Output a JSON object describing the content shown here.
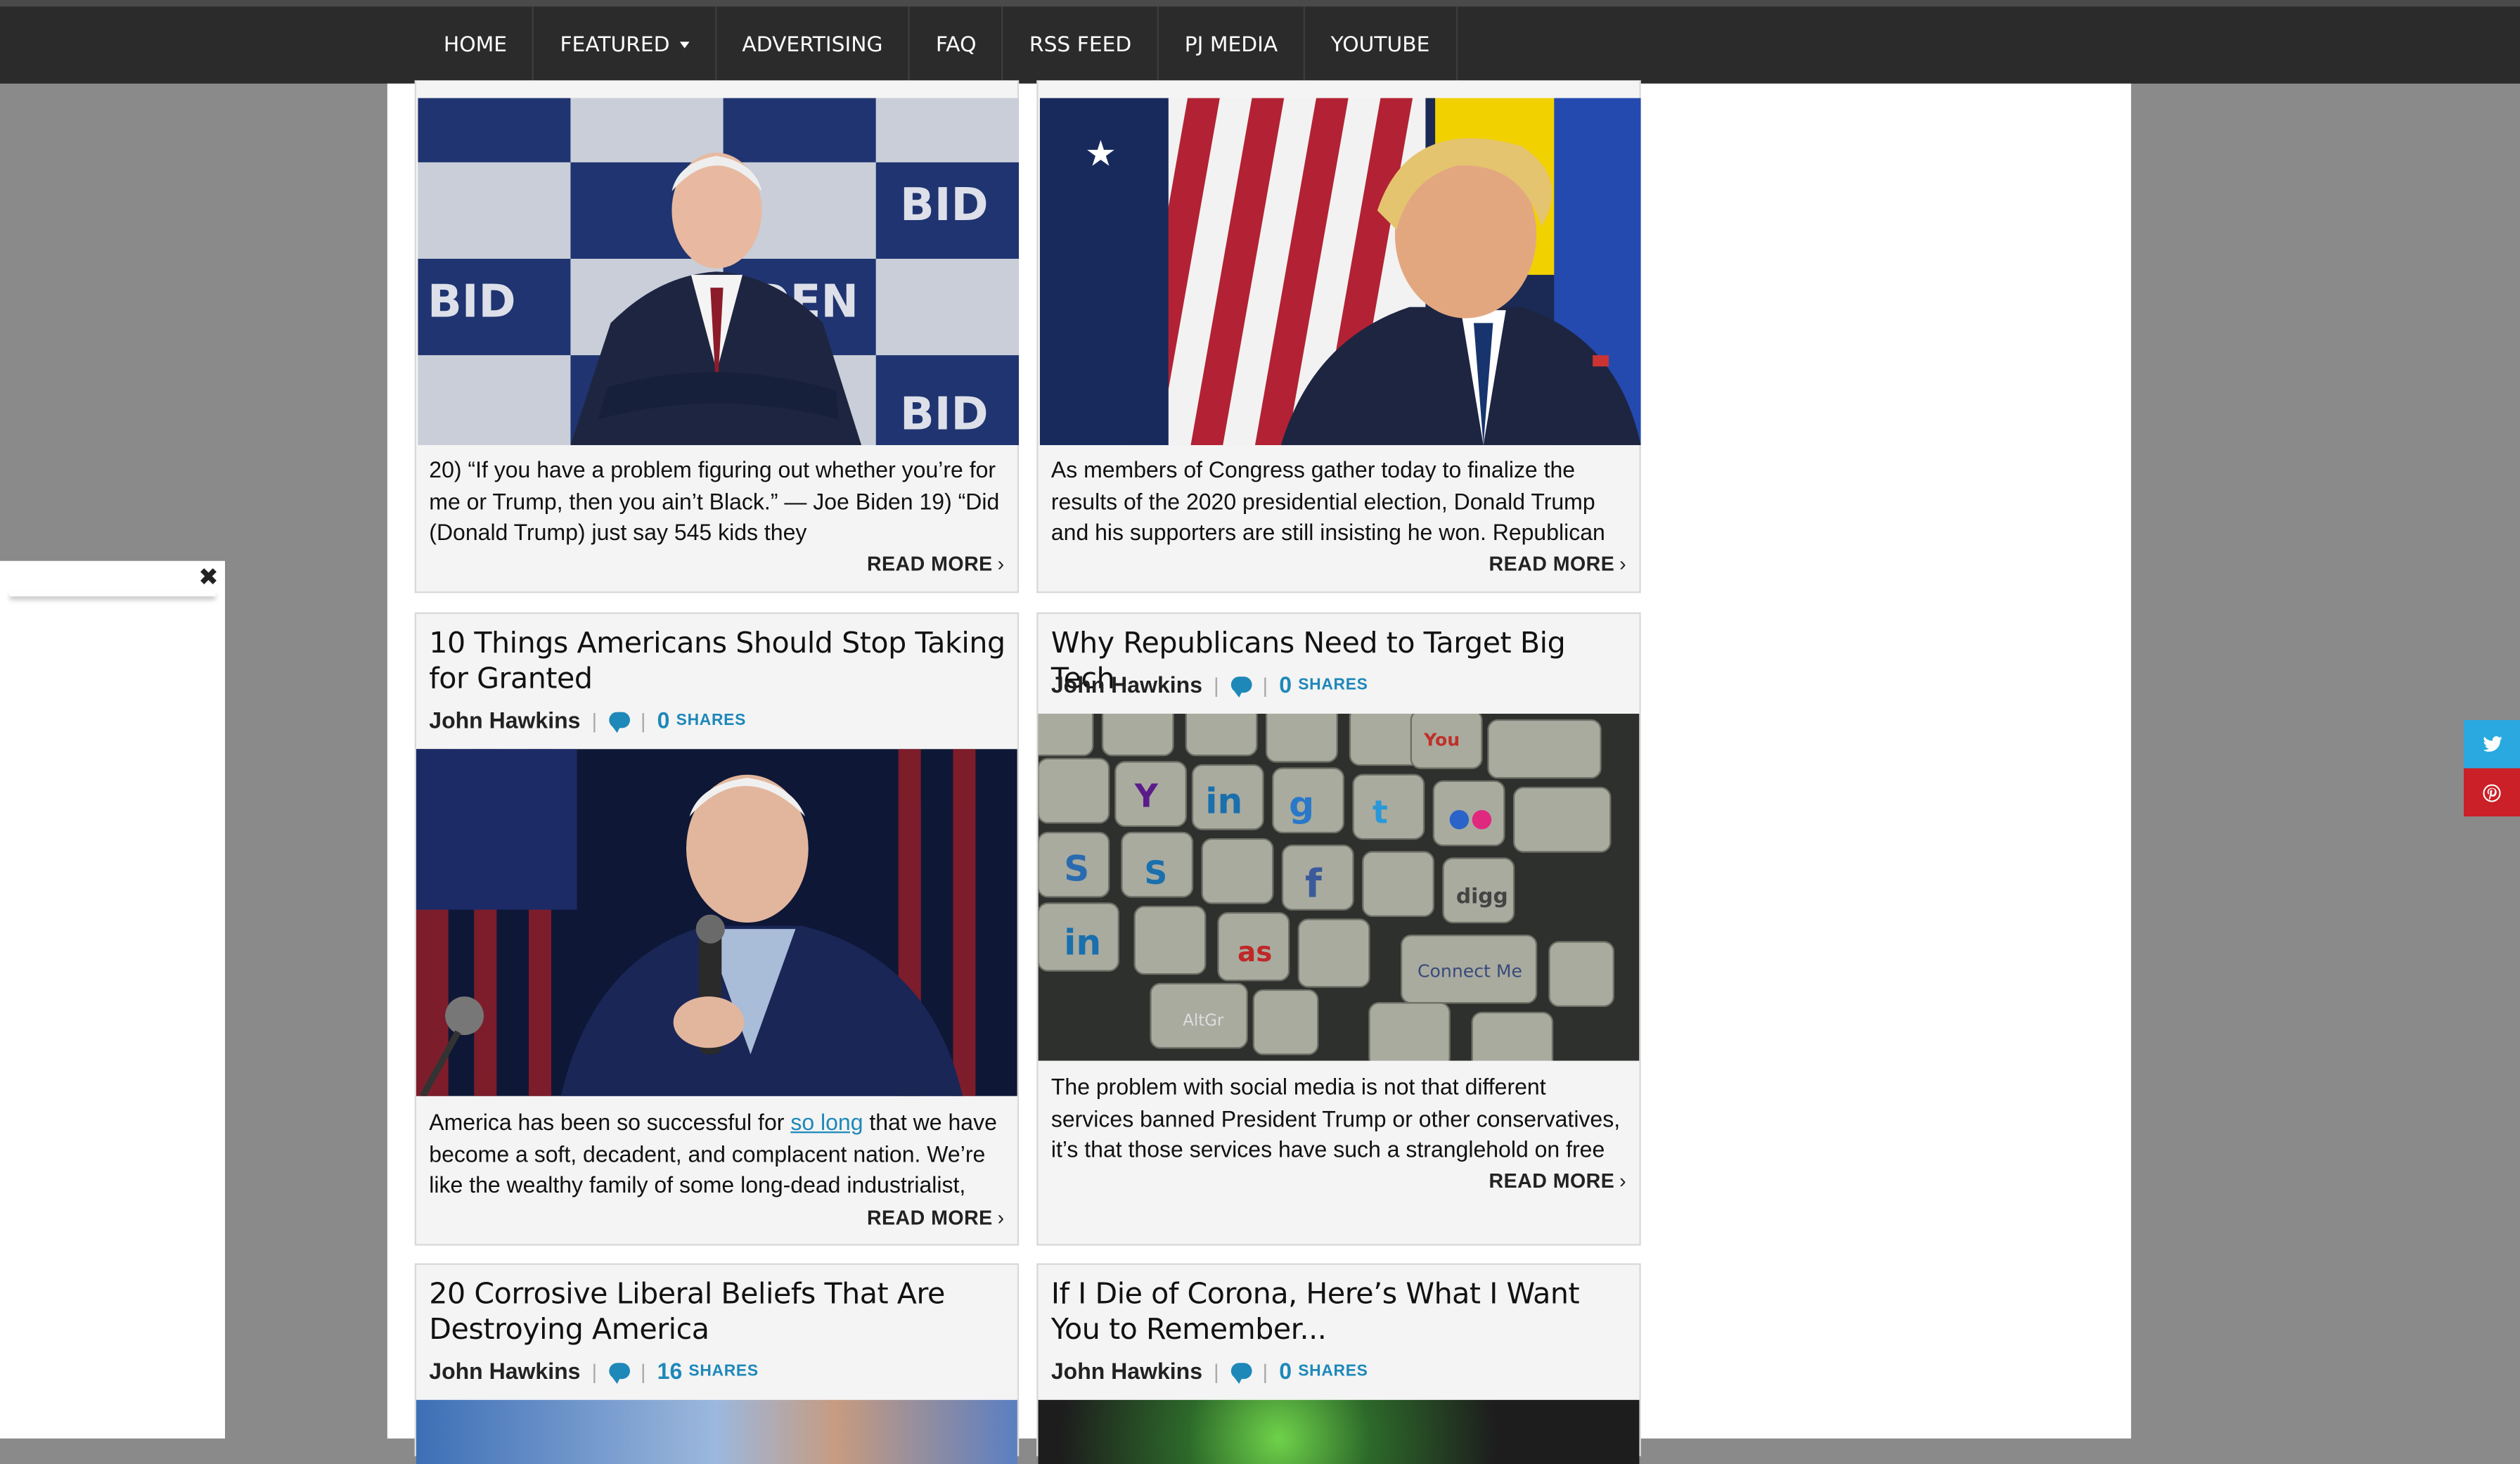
{
  "nav": {
    "items": [
      "HOME",
      "FEATURED",
      "ADVERTISING",
      "FAQ",
      "RSS FEED",
      "PJ MEDIA",
      "YOUTUBE"
    ]
  },
  "cards": [
    {
      "image_alt": "Joe Biden smiling with arms crossed in front of Biden campaign backdrop",
      "excerpt": "20) “If you have a problem figuring out whether you’re for me or Trump, then you ain’t Black.” — Joe Biden 19) “Did (Donald Trump) just say 545 kids they",
      "read_more": "READ MORE"
    },
    {
      "image_alt": "Donald Trump in front of American and Ukrainian flags",
      "excerpt": "As members of Congress gather today to finalize the results of the 2020 presidential election, Donald Trump and his supporters are still insisting he won. Republican",
      "read_more": "READ MORE"
    },
    {
      "title": "10 Things Americans Should Stop Taking for Granted",
      "author": "John Hawkins",
      "share_count": "0",
      "shares_label": "SHARES",
      "image_alt": "Joe Biden speaking into a microphone",
      "excerpt_before": "America has been so successful for ",
      "excerpt_link": "so long",
      "excerpt_after": " that we have become a soft, decadent, and complacent nation. We’re like the wealthy family of some long-dead industrialist,",
      "read_more": "READ MORE"
    },
    {
      "title": "Why Republicans Need to Target Big Tech",
      "author": "John Hawkins",
      "share_count": "0",
      "shares_label": "SHARES",
      "image_alt": "Keyboard with social media logo keys",
      "keyboard_keys": [
        "You Tube",
        "Y!",
        "in",
        "g",
        "t",
        "•• ",
        "S",
        "f",
        "digg",
        "in",
        "as",
        "Connect Me",
        "AltGr"
      ],
      "excerpt": "The problem with social media is not that different services banned President Trump or other conservatives, it’s that those services have such a stranglehold on free",
      "read_more": "READ MORE"
    },
    {
      "title": "20 Corrosive Liberal Beliefs That Are Destroying America",
      "author": "John Hawkins",
      "share_count": "16",
      "shares_label": "SHARES"
    },
    {
      "title": "If I Die of Corona, Here’s What I Want You to Remember...",
      "author": "John Hawkins",
      "share_count": "0",
      "shares_label": "SHARES"
    }
  ],
  "popup": {
    "close_glyph": "✖"
  },
  "share_bar": {
    "twitter_glyph": "🐦",
    "pinterest_glyph": "P"
  },
  "colors": {
    "accent": "#1e88b9",
    "navbar": "#2b2b2b",
    "twitter": "#2aa9e0",
    "pinterest": "#cb2027"
  }
}
